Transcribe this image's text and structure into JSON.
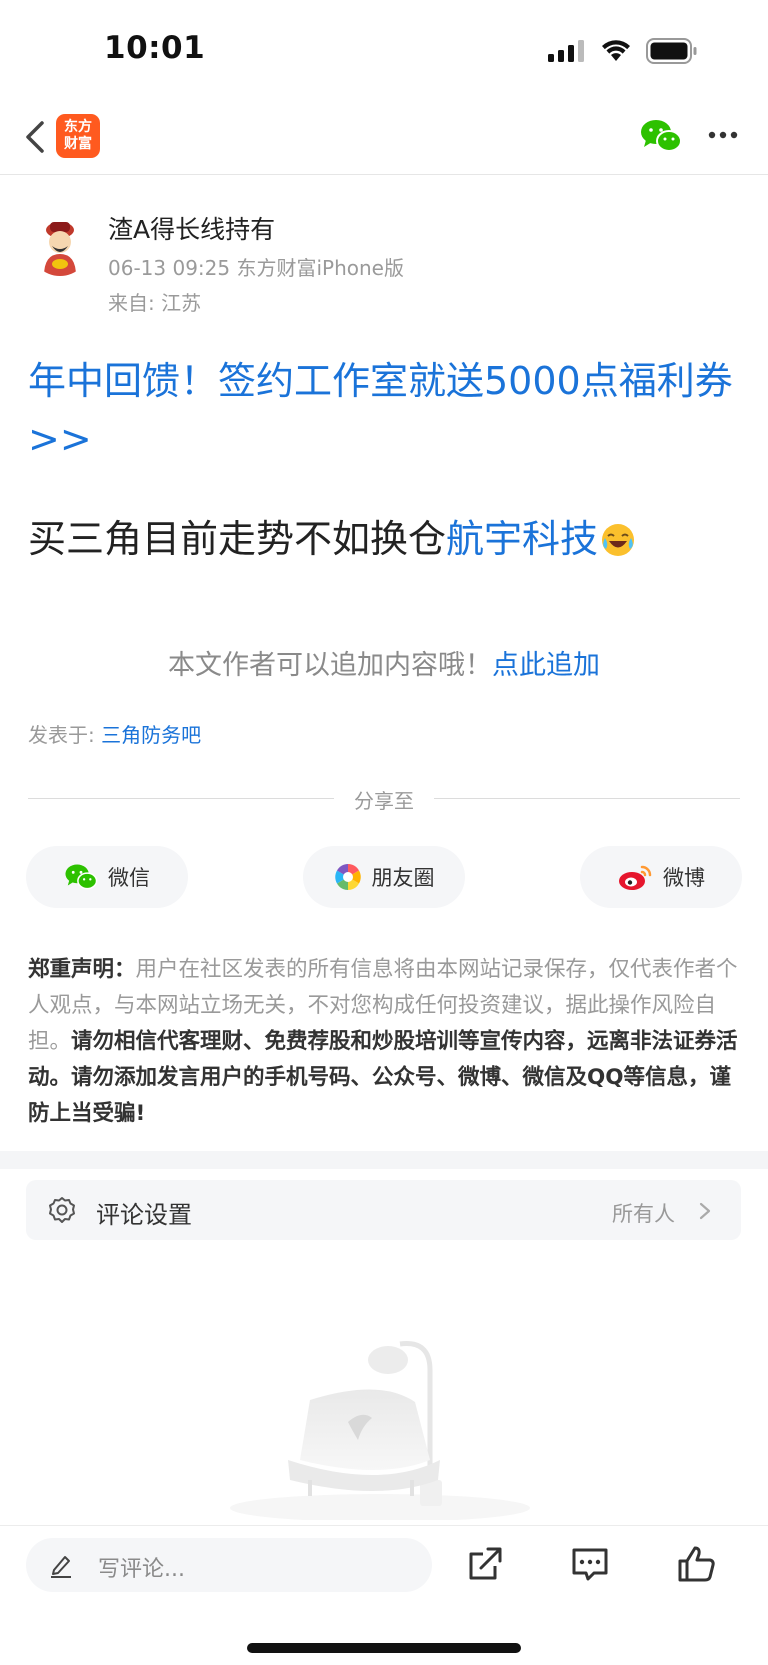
{
  "status_bar": {
    "time": "10:01"
  },
  "nav": {
    "logo_line1": "东方",
    "logo_line2": "财富"
  },
  "post": {
    "author": "渣A得长线持有",
    "meta": "06-13 09:25 东方财富iPhone版",
    "location": "来自: 江苏",
    "ad_title": "年中回馈！签约工作室就送5000点福利券>>",
    "body_text": "买三角目前走势不如换仓",
    "body_link": "航宇科技",
    "append_tip": "本文作者可以追加内容哦！",
    "append_link": "点此追加",
    "posted_in_label": "发表于: ",
    "posted_in_link": "三角防务吧"
  },
  "share": {
    "label": "分享至",
    "wechat": "微信",
    "moments": "朋友圈",
    "weibo": "微博"
  },
  "disclaimer": {
    "title": "郑重声明：",
    "text": "用户在社区发表的所有信息将由本网站记录保存，仅代表作者个人观点，与本网站立场无关，不对您构成任何投资建议，据此操作风险自担。",
    "bold_text": "请勿相信代客理财、免费荐股和炒股培训等宣传内容，远离非法证券活动。请勿添加发言用户的手机号码、公众号、微博、微信及QQ等信息，谨防上当受骗!"
  },
  "comment_setting": {
    "label": "评论设置",
    "value": "所有人"
  },
  "bottom_bar": {
    "placeholder": "写评论..."
  },
  "colors": {
    "link": "#1a73d9",
    "brand": "#ff5a1f",
    "wechat": "#2dc100"
  }
}
